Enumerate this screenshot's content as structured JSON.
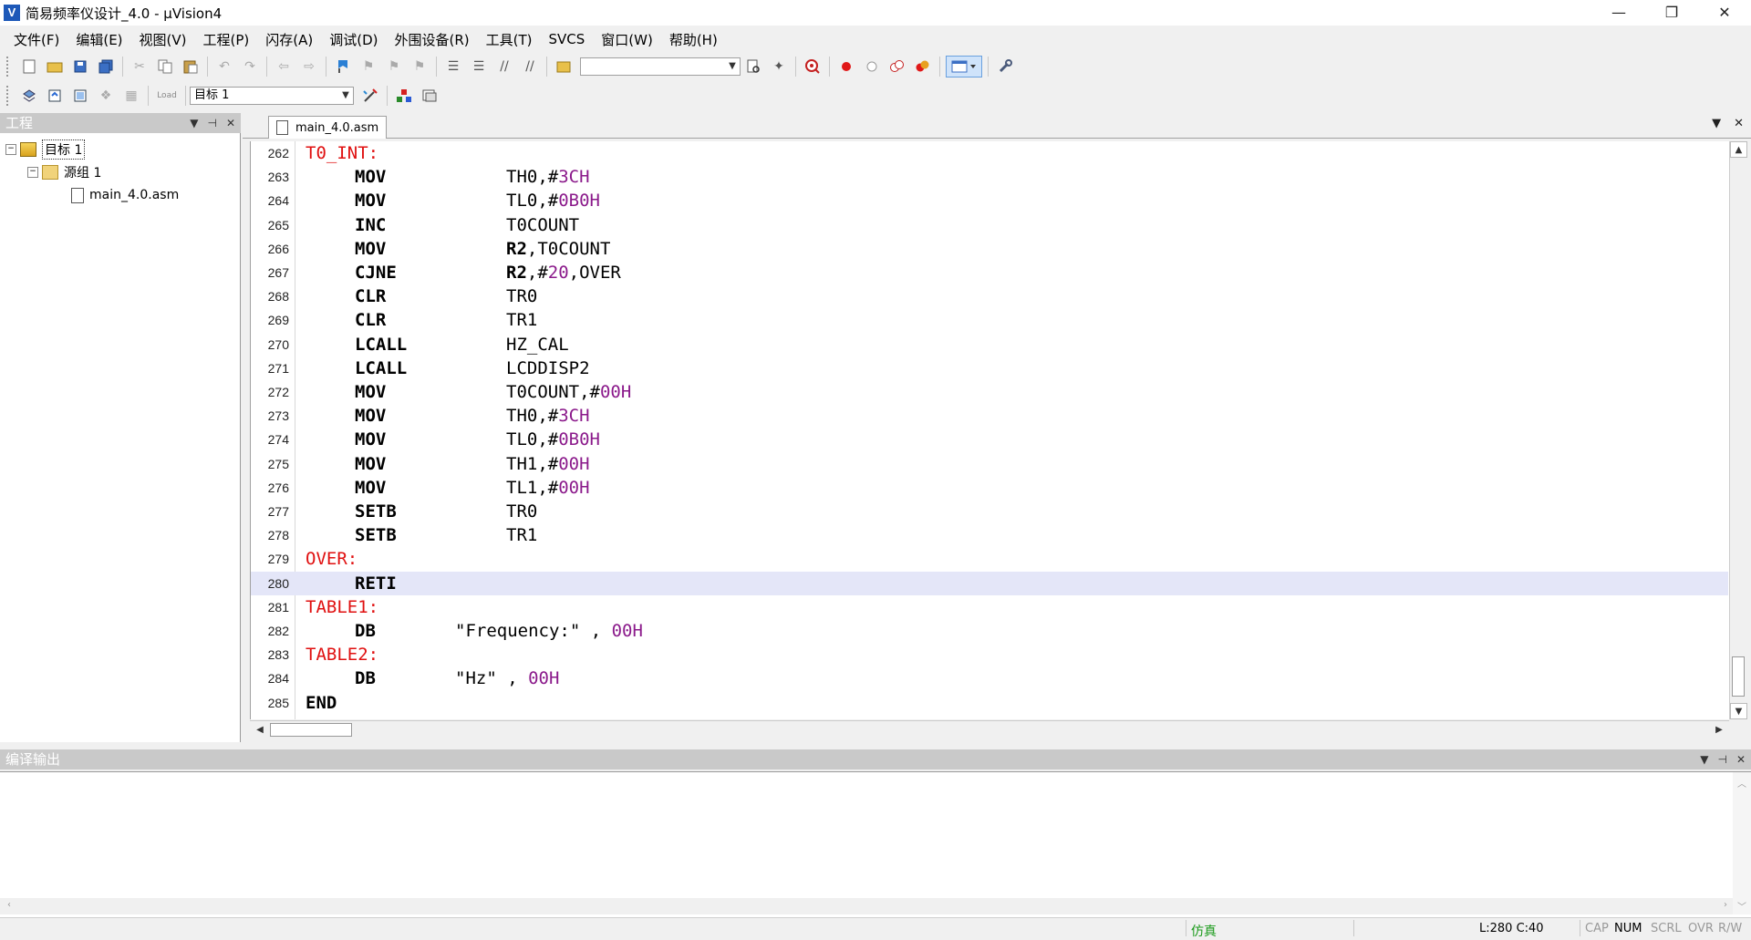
{
  "window": {
    "title": "简易频率仪设计_4.0  - µVision4",
    "app_icon": "V",
    "controls": [
      "—",
      "❐",
      "✕"
    ]
  },
  "menu": [
    "文件(F)",
    "编辑(E)",
    "视图(V)",
    "工程(P)",
    "闪存(A)",
    "调试(D)",
    "外围设备(R)",
    "工具(T)",
    "SVCS",
    "窗口(W)",
    "帮助(H)"
  ],
  "toolbar2": {
    "load_label": "Load",
    "target_select": "目标 1"
  },
  "project_panel": {
    "title": "工程",
    "tree": {
      "target": "目标 1",
      "group": "源组 1",
      "file": "main_4.0.asm"
    }
  },
  "editor": {
    "tab": "main_4.0.asm",
    "current_line": 280,
    "lines": [
      {
        "n": "262",
        "label": "T0_INT:",
        "op": "",
        "args": []
      },
      {
        "n": "263",
        "label": "",
        "op": "MOV",
        "args": [
          [
            "TH0,#",
            ""
          ],
          [
            "3CH",
            "num"
          ]
        ]
      },
      {
        "n": "264",
        "label": "",
        "op": "MOV",
        "args": [
          [
            "TL0,#",
            ""
          ],
          [
            "0B0H",
            "num"
          ]
        ]
      },
      {
        "n": "265",
        "label": "",
        "op": "INC",
        "args": [
          [
            "T0COUNT",
            ""
          ]
        ]
      },
      {
        "n": "266",
        "label": "",
        "op": "MOV",
        "args": [
          [
            "R2",
            "reg"
          ],
          [
            ",T0COUNT",
            ""
          ]
        ]
      },
      {
        "n": "267",
        "label": "",
        "op": "CJNE",
        "args": [
          [
            "R2",
            "reg"
          ],
          [
            ",#",
            ""
          ],
          [
            "20",
            "num"
          ],
          [
            ",OVER",
            ""
          ]
        ]
      },
      {
        "n": "268",
        "label": "",
        "op": "CLR",
        "args": [
          [
            "TR0",
            ""
          ]
        ]
      },
      {
        "n": "269",
        "label": "",
        "op": "CLR",
        "args": [
          [
            "TR1",
            ""
          ]
        ]
      },
      {
        "n": "270",
        "label": "",
        "op": "LCALL",
        "args": [
          [
            "HZ_CAL",
            ""
          ]
        ]
      },
      {
        "n": "271",
        "label": "",
        "op": "LCALL",
        "args": [
          [
            "LCDDISP2",
            ""
          ]
        ]
      },
      {
        "n": "272",
        "label": "",
        "op": "MOV",
        "args": [
          [
            "T0COUNT,#",
            ""
          ],
          [
            "00H",
            "num"
          ]
        ]
      },
      {
        "n": "273",
        "label": "",
        "op": "MOV",
        "args": [
          [
            "TH0,#",
            ""
          ],
          [
            "3CH",
            "num"
          ]
        ]
      },
      {
        "n": "274",
        "label": "",
        "op": "MOV",
        "args": [
          [
            "TL0,#",
            ""
          ],
          [
            "0B0H",
            "num"
          ]
        ]
      },
      {
        "n": "275",
        "label": "",
        "op": "MOV",
        "args": [
          [
            "TH1,#",
            ""
          ],
          [
            "00H",
            "num"
          ]
        ]
      },
      {
        "n": "276",
        "label": "",
        "op": "MOV",
        "args": [
          [
            "TL1,#",
            ""
          ],
          [
            "00H",
            "num"
          ]
        ]
      },
      {
        "n": "277",
        "label": "",
        "op": "SETB",
        "args": [
          [
            "TR0",
            ""
          ]
        ]
      },
      {
        "n": "278",
        "label": "",
        "op": "SETB",
        "args": [
          [
            "TR1",
            ""
          ]
        ]
      },
      {
        "n": "279",
        "label": "OVER:",
        "op": "",
        "args": []
      },
      {
        "n": "280",
        "label": "",
        "op": "RETI",
        "args": []
      },
      {
        "n": "281",
        "label": "TABLE1:",
        "op": "",
        "args": []
      },
      {
        "n": "282",
        "label": "",
        "op": "DB",
        "db": true,
        "args": [
          [
            "\"Frequency:\" , ",
            ""
          ],
          [
            "00H",
            "num"
          ]
        ]
      },
      {
        "n": "283",
        "label": "TABLE2:",
        "op": "",
        "args": []
      },
      {
        "n": "284",
        "label": "",
        "op": "DB",
        "db": true,
        "args": [
          [
            "\"Hz\" , ",
            ""
          ],
          [
            "00H",
            "num"
          ]
        ]
      },
      {
        "n": "285",
        "label": "",
        "op": "END",
        "end": true,
        "args": []
      }
    ]
  },
  "output_panel": {
    "title": "编译输出"
  },
  "status": {
    "mode": "仿真",
    "position": "L:280 C:40",
    "caps": "CAP",
    "num": "NUM",
    "scrl": "SCRL",
    "ovr": "OVR",
    "rw": "R/W"
  },
  "colors": {
    "label": "#e01010",
    "number": "#8b1a8b",
    "current_line": "#e4e6f8",
    "sim_status": "#1a9a1a"
  }
}
